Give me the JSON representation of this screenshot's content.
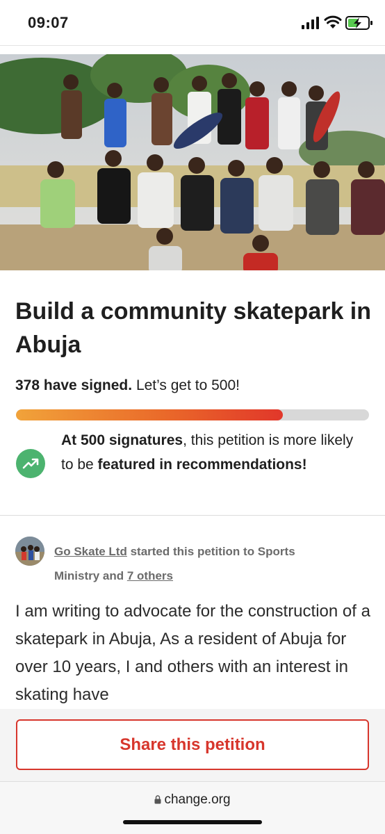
{
  "status_bar": {
    "time": "09:07"
  },
  "petition": {
    "title": "Build a community skatepark in Abuja",
    "signed_count_text": "378 have signed.",
    "goal_text": "Let’s get to 500!",
    "progress_fraction": 0.756,
    "milestone": {
      "bold_1": "At 500 signatures",
      "text_1": ", this petition is more likely to be ",
      "bold_2": "featured in recommendations!"
    },
    "starter": {
      "name": "Go Skate Ltd",
      "text": " started this petition to Sports Ministry and ",
      "others_link": "7 others"
    },
    "body": " I am writing to advocate for the construction of a skatepark in Abuja, As a resident of Abuja for over 10 years, I and others with an interest in skating have"
  },
  "share_button_label": "Share this petition",
  "browser": {
    "url": "change.org"
  },
  "colors": {
    "accent": "#d7362c",
    "progress_start": "#f1a33a",
    "progress_end": "#e1372a",
    "trend_green": "#4cb36f"
  },
  "icons": {
    "signal": "signal-icon",
    "wifi": "wifi-icon",
    "battery": "battery-charging-icon",
    "trend": "trend-up-icon",
    "lock": "lock-icon"
  }
}
